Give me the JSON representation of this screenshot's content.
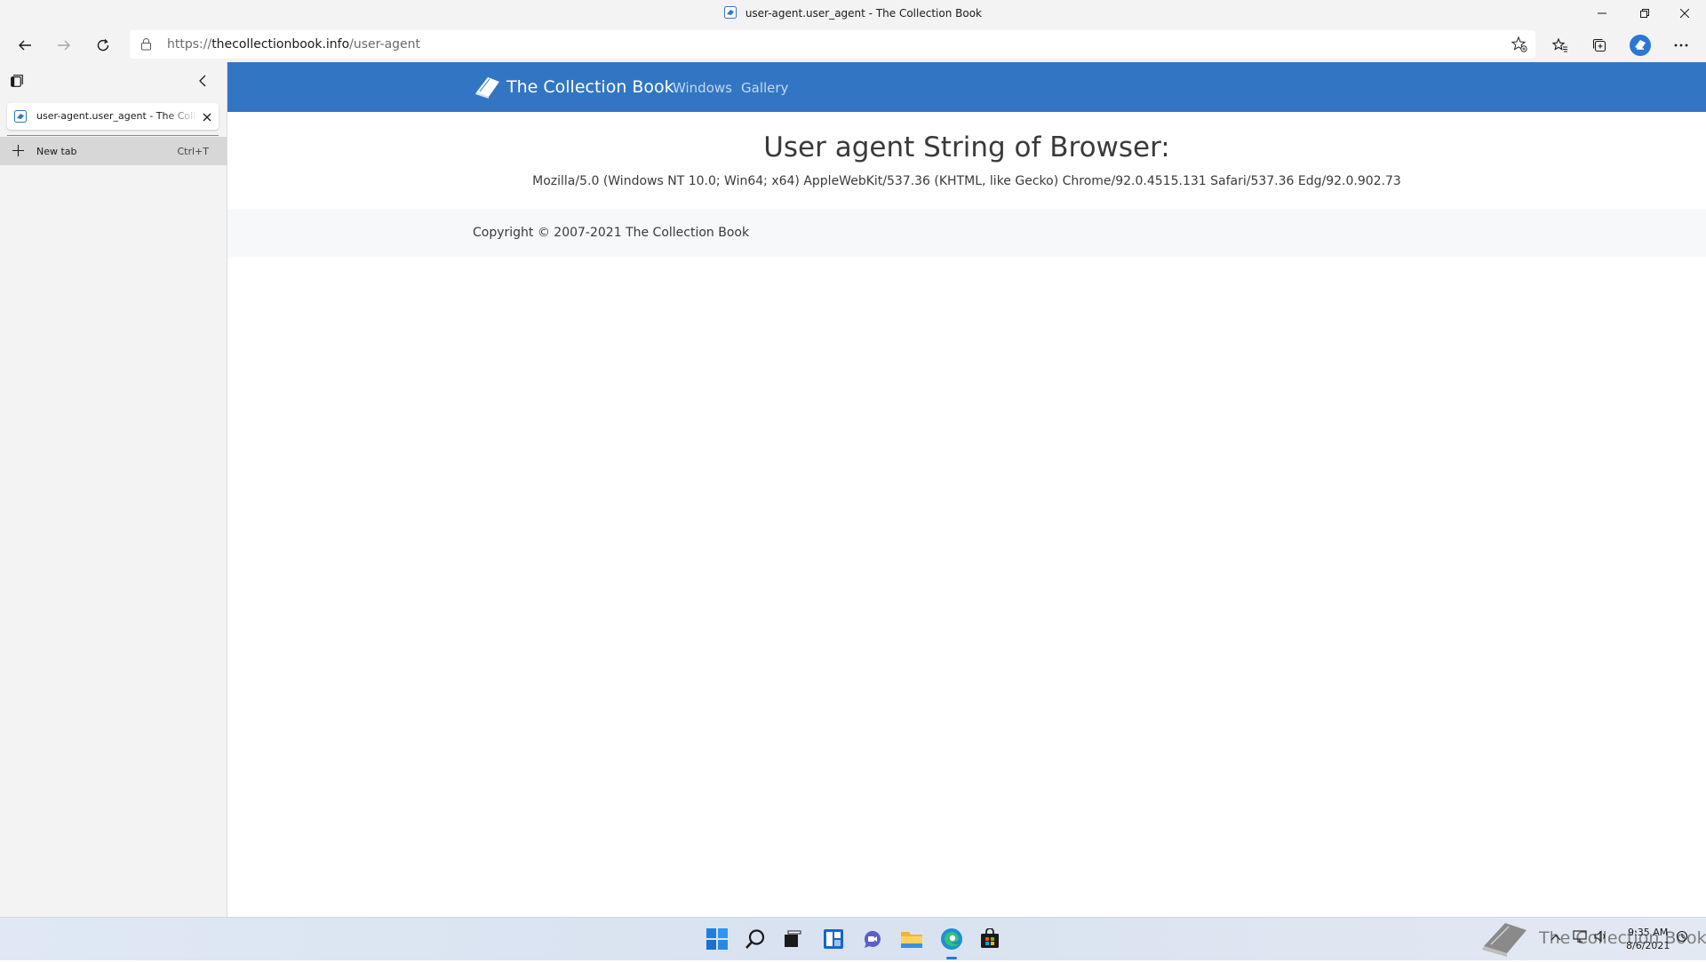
{
  "window": {
    "title": "user-agent.user_agent - The Collection Book"
  },
  "toolbar": {
    "url_scheme": "https://",
    "url_host": "thecollectionbook.info",
    "url_path": "/user-agent"
  },
  "sidebar": {
    "tabs": [
      {
        "label": "user-agent.user_agent - The Collection Book",
        "active": true
      }
    ],
    "new_tab_label": "New tab",
    "new_tab_shortcut": "Ctrl+T"
  },
  "site": {
    "brand": "The Collection Book",
    "nav": [
      "Windows",
      "Gallery"
    ],
    "heading": "User agent String of Browser:",
    "user_agent": "Mozilla/5.0 (Windows NT 10.0; Win64; x64) AppleWebKit/537.36 (KHTML, like Gecko) Chrome/92.0.4515.131 Safari/537.36 Edg/92.0.902.73",
    "copyright": "Copyright © 2007-2021 The Collection Book"
  },
  "taskbar": {
    "apps": [
      "start-icon",
      "search-icon",
      "task-view-icon",
      "widgets-icon",
      "chat-icon",
      "file-explorer-icon",
      "edge-icon",
      "store-icon"
    ],
    "watermark": "The Collection Book",
    "time": "9:35 AM",
    "date": "8/6/2021"
  },
  "colors": {
    "navbar": "#3276c3",
    "nav_link": "#c4d8f1",
    "chrome_bg": "#f3f3f3",
    "footer_bg": "#f7f8fa"
  }
}
